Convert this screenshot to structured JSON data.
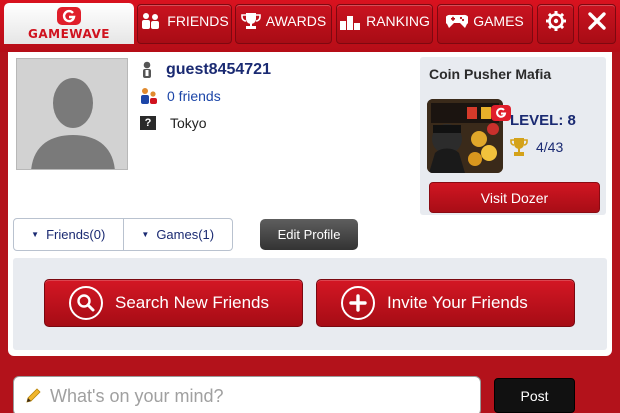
{
  "brand": {
    "name": "GAMEWAVE",
    "accent": "#d0121e"
  },
  "nav": {
    "friends_label": "FRIENDS",
    "awards_label": "AWARDS",
    "ranking_label": "RANKING",
    "games_label": "GAMES",
    "settings_icon": "gear-icon",
    "close_icon": "close-icon"
  },
  "profile": {
    "username": "guest8454721",
    "friends": "0 friends",
    "location": "Tokyo",
    "location_icon_glyph": "?"
  },
  "game_card": {
    "title": "Coin Pusher Mafia",
    "level": "LEVEL: 8",
    "awards": "4/43",
    "visit_label": "Visit Dozer"
  },
  "tabs": {
    "friends_label": "Friends(0)",
    "games_label": "Games(1)",
    "caret": "▼"
  },
  "edit_profile_label": "Edit Profile",
  "actions": {
    "search_label": "Search New Friends",
    "invite_label": "Invite Your Friends"
  },
  "post": {
    "placeholder": "What's on your mind?",
    "button_label": "Post"
  }
}
